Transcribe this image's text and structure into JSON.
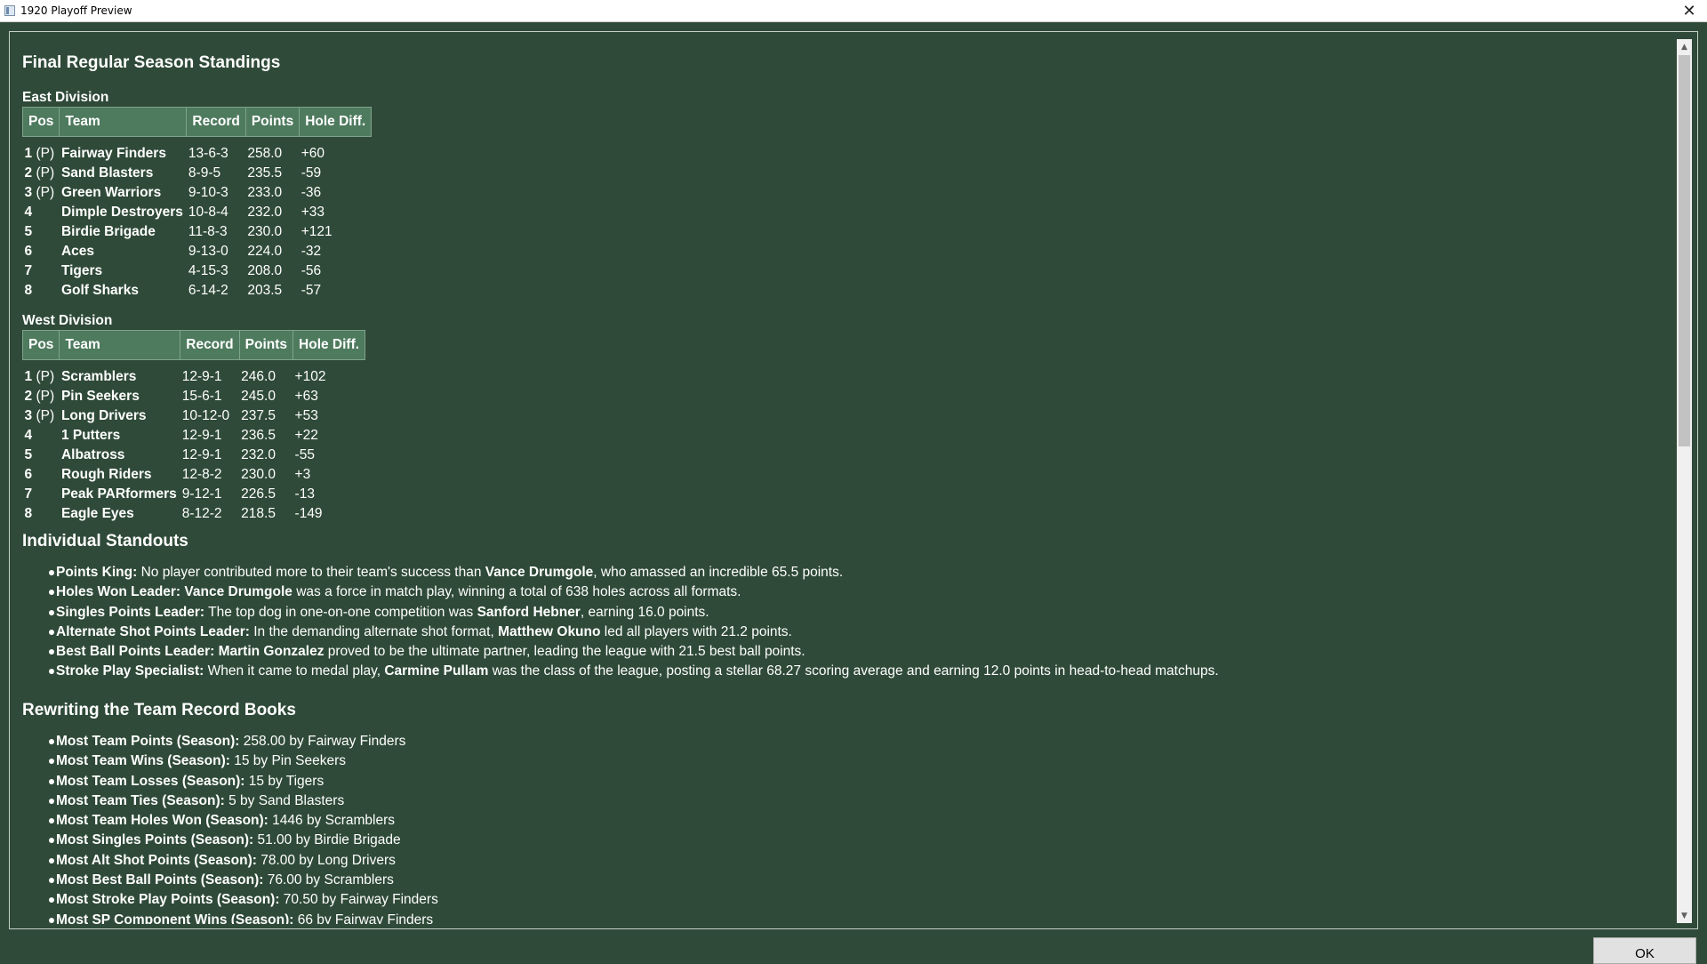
{
  "window": {
    "title": "1920 Playoff Preview",
    "close_glyph": "✕"
  },
  "heading_standings": "Final Regular Season Standings",
  "columns": {
    "pos": "Pos",
    "team": "Team",
    "record": "Record",
    "points": "Points",
    "hole_diff": "Hole Diff."
  },
  "east": {
    "title": "East Division",
    "rows": [
      {
        "pos": "1",
        "tag": "(P)",
        "team": "Fairway Finders",
        "record": "13-6-3",
        "points": "258.0",
        "diff": "+60"
      },
      {
        "pos": "2",
        "tag": "(P)",
        "team": "Sand Blasters",
        "record": "8-9-5",
        "points": "235.5",
        "diff": "-59"
      },
      {
        "pos": "3",
        "tag": "(P)",
        "team": "Green Warriors",
        "record": "9-10-3",
        "points": "233.0",
        "diff": "-36"
      },
      {
        "pos": "4",
        "tag": "",
        "team": "Dimple Destroyers",
        "record": "10-8-4",
        "points": "232.0",
        "diff": "+33"
      },
      {
        "pos": "5",
        "tag": "",
        "team": "Birdie Brigade",
        "record": "11-8-3",
        "points": "230.0",
        "diff": "+121"
      },
      {
        "pos": "6",
        "tag": "",
        "team": "Aces",
        "record": "9-13-0",
        "points": "224.0",
        "diff": "-32"
      },
      {
        "pos": "7",
        "tag": "",
        "team": "Tigers",
        "record": "4-15-3",
        "points": "208.0",
        "diff": "-56"
      },
      {
        "pos": "8",
        "tag": "",
        "team": "Golf Sharks",
        "record": "6-14-2",
        "points": "203.5",
        "diff": "-57"
      }
    ]
  },
  "west": {
    "title": "West Division",
    "rows": [
      {
        "pos": "1",
        "tag": "(P)",
        "team": "Scramblers",
        "record": "12-9-1",
        "points": "246.0",
        "diff": "+102"
      },
      {
        "pos": "2",
        "tag": "(P)",
        "team": "Pin Seekers",
        "record": "15-6-1",
        "points": "245.0",
        "diff": "+63"
      },
      {
        "pos": "3",
        "tag": "(P)",
        "team": "Long Drivers",
        "record": "10-12-0",
        "points": "237.5",
        "diff": "+53"
      },
      {
        "pos": "4",
        "tag": "",
        "team": "1 Putters",
        "record": "12-9-1",
        "points": "236.5",
        "diff": "+22"
      },
      {
        "pos": "5",
        "tag": "",
        "team": "Albatross",
        "record": "12-9-1",
        "points": "232.0",
        "diff": "-55"
      },
      {
        "pos": "6",
        "tag": "",
        "team": "Rough Riders",
        "record": "12-8-2",
        "points": "230.0",
        "diff": "+3"
      },
      {
        "pos": "7",
        "tag": "",
        "team": "Peak PARformers",
        "record": "9-12-1",
        "points": "226.5",
        "diff": "-13"
      },
      {
        "pos": "8",
        "tag": "",
        "team": "Eagle Eyes",
        "record": "8-12-2",
        "points": "218.5",
        "diff": "-149"
      }
    ]
  },
  "standouts": {
    "title": "Individual Standouts",
    "items": [
      {
        "label": "Points King:",
        "pre": " No player contributed more to their team's success than ",
        "name": "Vance Drumgole",
        "post": ", who amassed an incredible 65.5 points."
      },
      {
        "label": "Holes Won Leader:",
        "pre": " ",
        "name": "Vance Drumgole",
        "post": " was a force in match play, winning a total of 638 holes across all formats."
      },
      {
        "label": "Singles Points Leader:",
        "pre": " The top dog in one-on-one competition was ",
        "name": "Sanford Hebner",
        "post": ", earning 16.0 points."
      },
      {
        "label": "Alternate Shot Points Leader:",
        "pre": " In the demanding alternate shot format, ",
        "name": "Matthew Okuno",
        "post": " led all players with 21.2 points."
      },
      {
        "label": "Best Ball Points Leader:",
        "pre": " ",
        "name": "Martin Gonzalez",
        "post": " proved to be the ultimate partner, leading the league with 21.5 best ball points."
      },
      {
        "label": "Stroke Play Specialist:",
        "pre": " When it came to medal play, ",
        "name": "Carmine Pullam",
        "post": " was the class of the league, posting a stellar 68.27 scoring average and earning 12.0 points in head-to-head matchups."
      }
    ]
  },
  "records": {
    "title": "Rewriting the Team Record Books",
    "items": [
      {
        "label": "Most Team Points (Season):",
        "value": " 258.00 by Fairway Finders"
      },
      {
        "label": "Most Team Wins (Season):",
        "value": " 15 by Pin Seekers"
      },
      {
        "label": "Most Team Losses (Season):",
        "value": " 15 by Tigers"
      },
      {
        "label": "Most Team Ties (Season):",
        "value": " 5 by Sand Blasters"
      },
      {
        "label": "Most Team Holes Won (Season):",
        "value": " 1446 by Scramblers"
      },
      {
        "label": "Most Singles Points (Season):",
        "value": " 51.00 by Birdie Brigade"
      },
      {
        "label": "Most Alt Shot Points (Season):",
        "value": " 78.00 by Long Drivers"
      },
      {
        "label": "Most Best Ball Points (Season):",
        "value": " 76.00 by Scramblers"
      },
      {
        "label": "Most Stroke Play Points (Season):",
        "value": " 70.50 by Fairway Finders"
      },
      {
        "label": "Most SP Component Wins (Season):",
        "value": " 66 by Fairway Finders"
      }
    ]
  },
  "ok_label": "OK"
}
